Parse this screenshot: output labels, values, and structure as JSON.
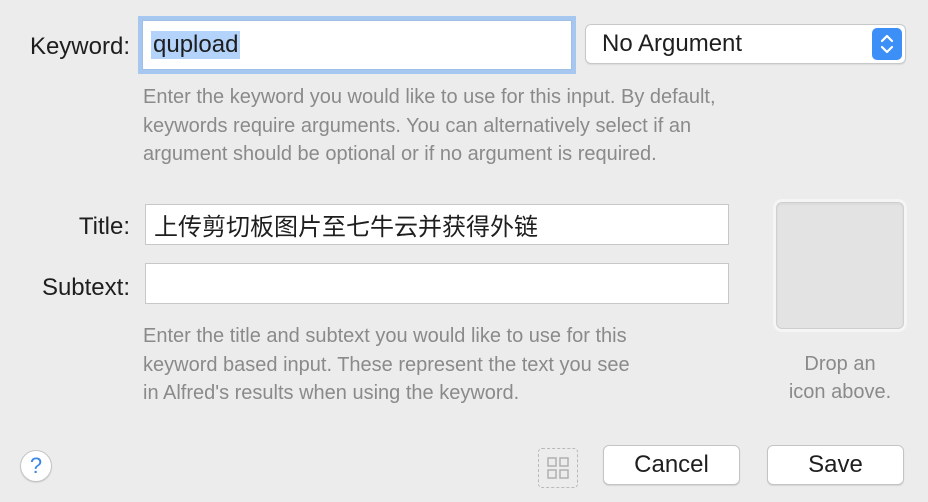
{
  "keyword": {
    "label": "Keyword:",
    "value": "qupload",
    "argument_select": "No Argument",
    "help": [
      "Enter the keyword you would like to use for this input. By default,",
      "keywords require arguments. You can alternatively select if an",
      "argument should be optional or if no argument is required."
    ]
  },
  "title": {
    "label": "Title:",
    "value": "上传剪切板图片至七牛云并获得外链"
  },
  "subtext": {
    "label": "Subtext:",
    "value": ""
  },
  "title_help": [
    "Enter the title and subtext you would like to use for this",
    "keyword based input. These represent the text you see",
    "in Alfred's results when using the keyword."
  ],
  "icon_well": {
    "drop_text": [
      "Drop an",
      "icon above."
    ]
  },
  "footer": {
    "help_glyph": "?",
    "cancel_label": "Cancel",
    "save_label": "Save"
  },
  "colors": {
    "accent": "#3b8ff7",
    "focus_ring": "#a6c8f0",
    "selection": "#b3d3fb"
  },
  "icons": [
    "up-down-chevrons-icon",
    "question-icon",
    "grid-icon"
  ]
}
